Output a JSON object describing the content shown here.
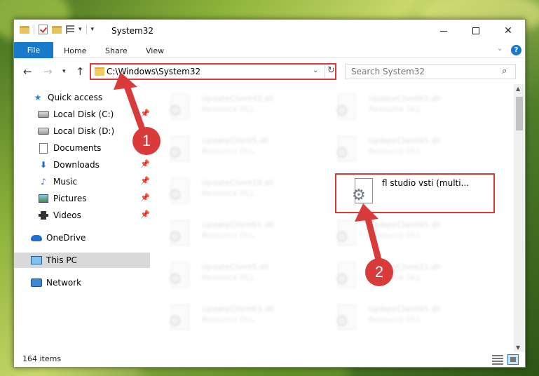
{
  "window": {
    "title": "System32",
    "controls": {
      "minimize": "minimize",
      "maximize": "maximize",
      "close": "✕"
    }
  },
  "ribbon": {
    "file_tab": "File",
    "tabs": [
      "Home",
      "Share",
      "View"
    ],
    "help": "?"
  },
  "address": {
    "path": "C:\\Windows\\System32",
    "refresh": "↻",
    "dropdown": "⌄"
  },
  "search": {
    "placeholder": "Search System32"
  },
  "sidebar": {
    "items": [
      {
        "label": "Quick access",
        "icon": "star-icon"
      },
      {
        "label": "Local Disk (C:)",
        "icon": "disk-icon",
        "pinned": true
      },
      {
        "label": "Local Disk (D:)",
        "icon": "disk-icon"
      },
      {
        "label": "Documents",
        "icon": "document-icon"
      },
      {
        "label": "Downloads",
        "icon": "download-icon",
        "pinned": true
      },
      {
        "label": "Music",
        "icon": "music-icon",
        "pinned": true
      },
      {
        "label": "Pictures",
        "icon": "picture-icon",
        "pinned": true
      },
      {
        "label": "Videos",
        "icon": "video-icon",
        "pinned": true
      },
      {
        "label": "OneDrive",
        "icon": "cloud-icon"
      },
      {
        "label": "This PC",
        "icon": "computer-icon",
        "selected": true
      },
      {
        "label": "Network",
        "icon": "network-icon"
      }
    ]
  },
  "files": [
    {
      "name": "UpdateClient42.dll",
      "type": "Resource DLL"
    },
    {
      "name": "UpdateClient63.dll",
      "type": "Resource DLL"
    },
    {
      "name": "UpdateClient5.dll",
      "type": "Resource DLL"
    },
    {
      "name": "UpdateClient65.dll",
      "type": "Resource DLL"
    },
    {
      "name": "UpdateClient19.dll",
      "type": "Resource DLL"
    },
    {
      "name": "fl studio vsti (multi...",
      "type": ""
    },
    {
      "name": "UpdateClient65.dll",
      "type": "Resource DLL"
    },
    {
      "name": "UpdateClient65.dll",
      "type": "Resource DLL"
    },
    {
      "name": "UpdateClient5.dll",
      "type": "Resource DLL"
    },
    {
      "name": "UpdateClient21.dll",
      "type": "Resource DLL"
    },
    {
      "name": "UpdateClient63.dll",
      "type": "Resource DLL"
    },
    {
      "name": "UpdateClient65.dll",
      "type": "Resource DLL"
    }
  ],
  "status": {
    "item_count": "164 items"
  },
  "annotations": {
    "step1": "1",
    "step2": "2",
    "color": "#d93a3a"
  }
}
